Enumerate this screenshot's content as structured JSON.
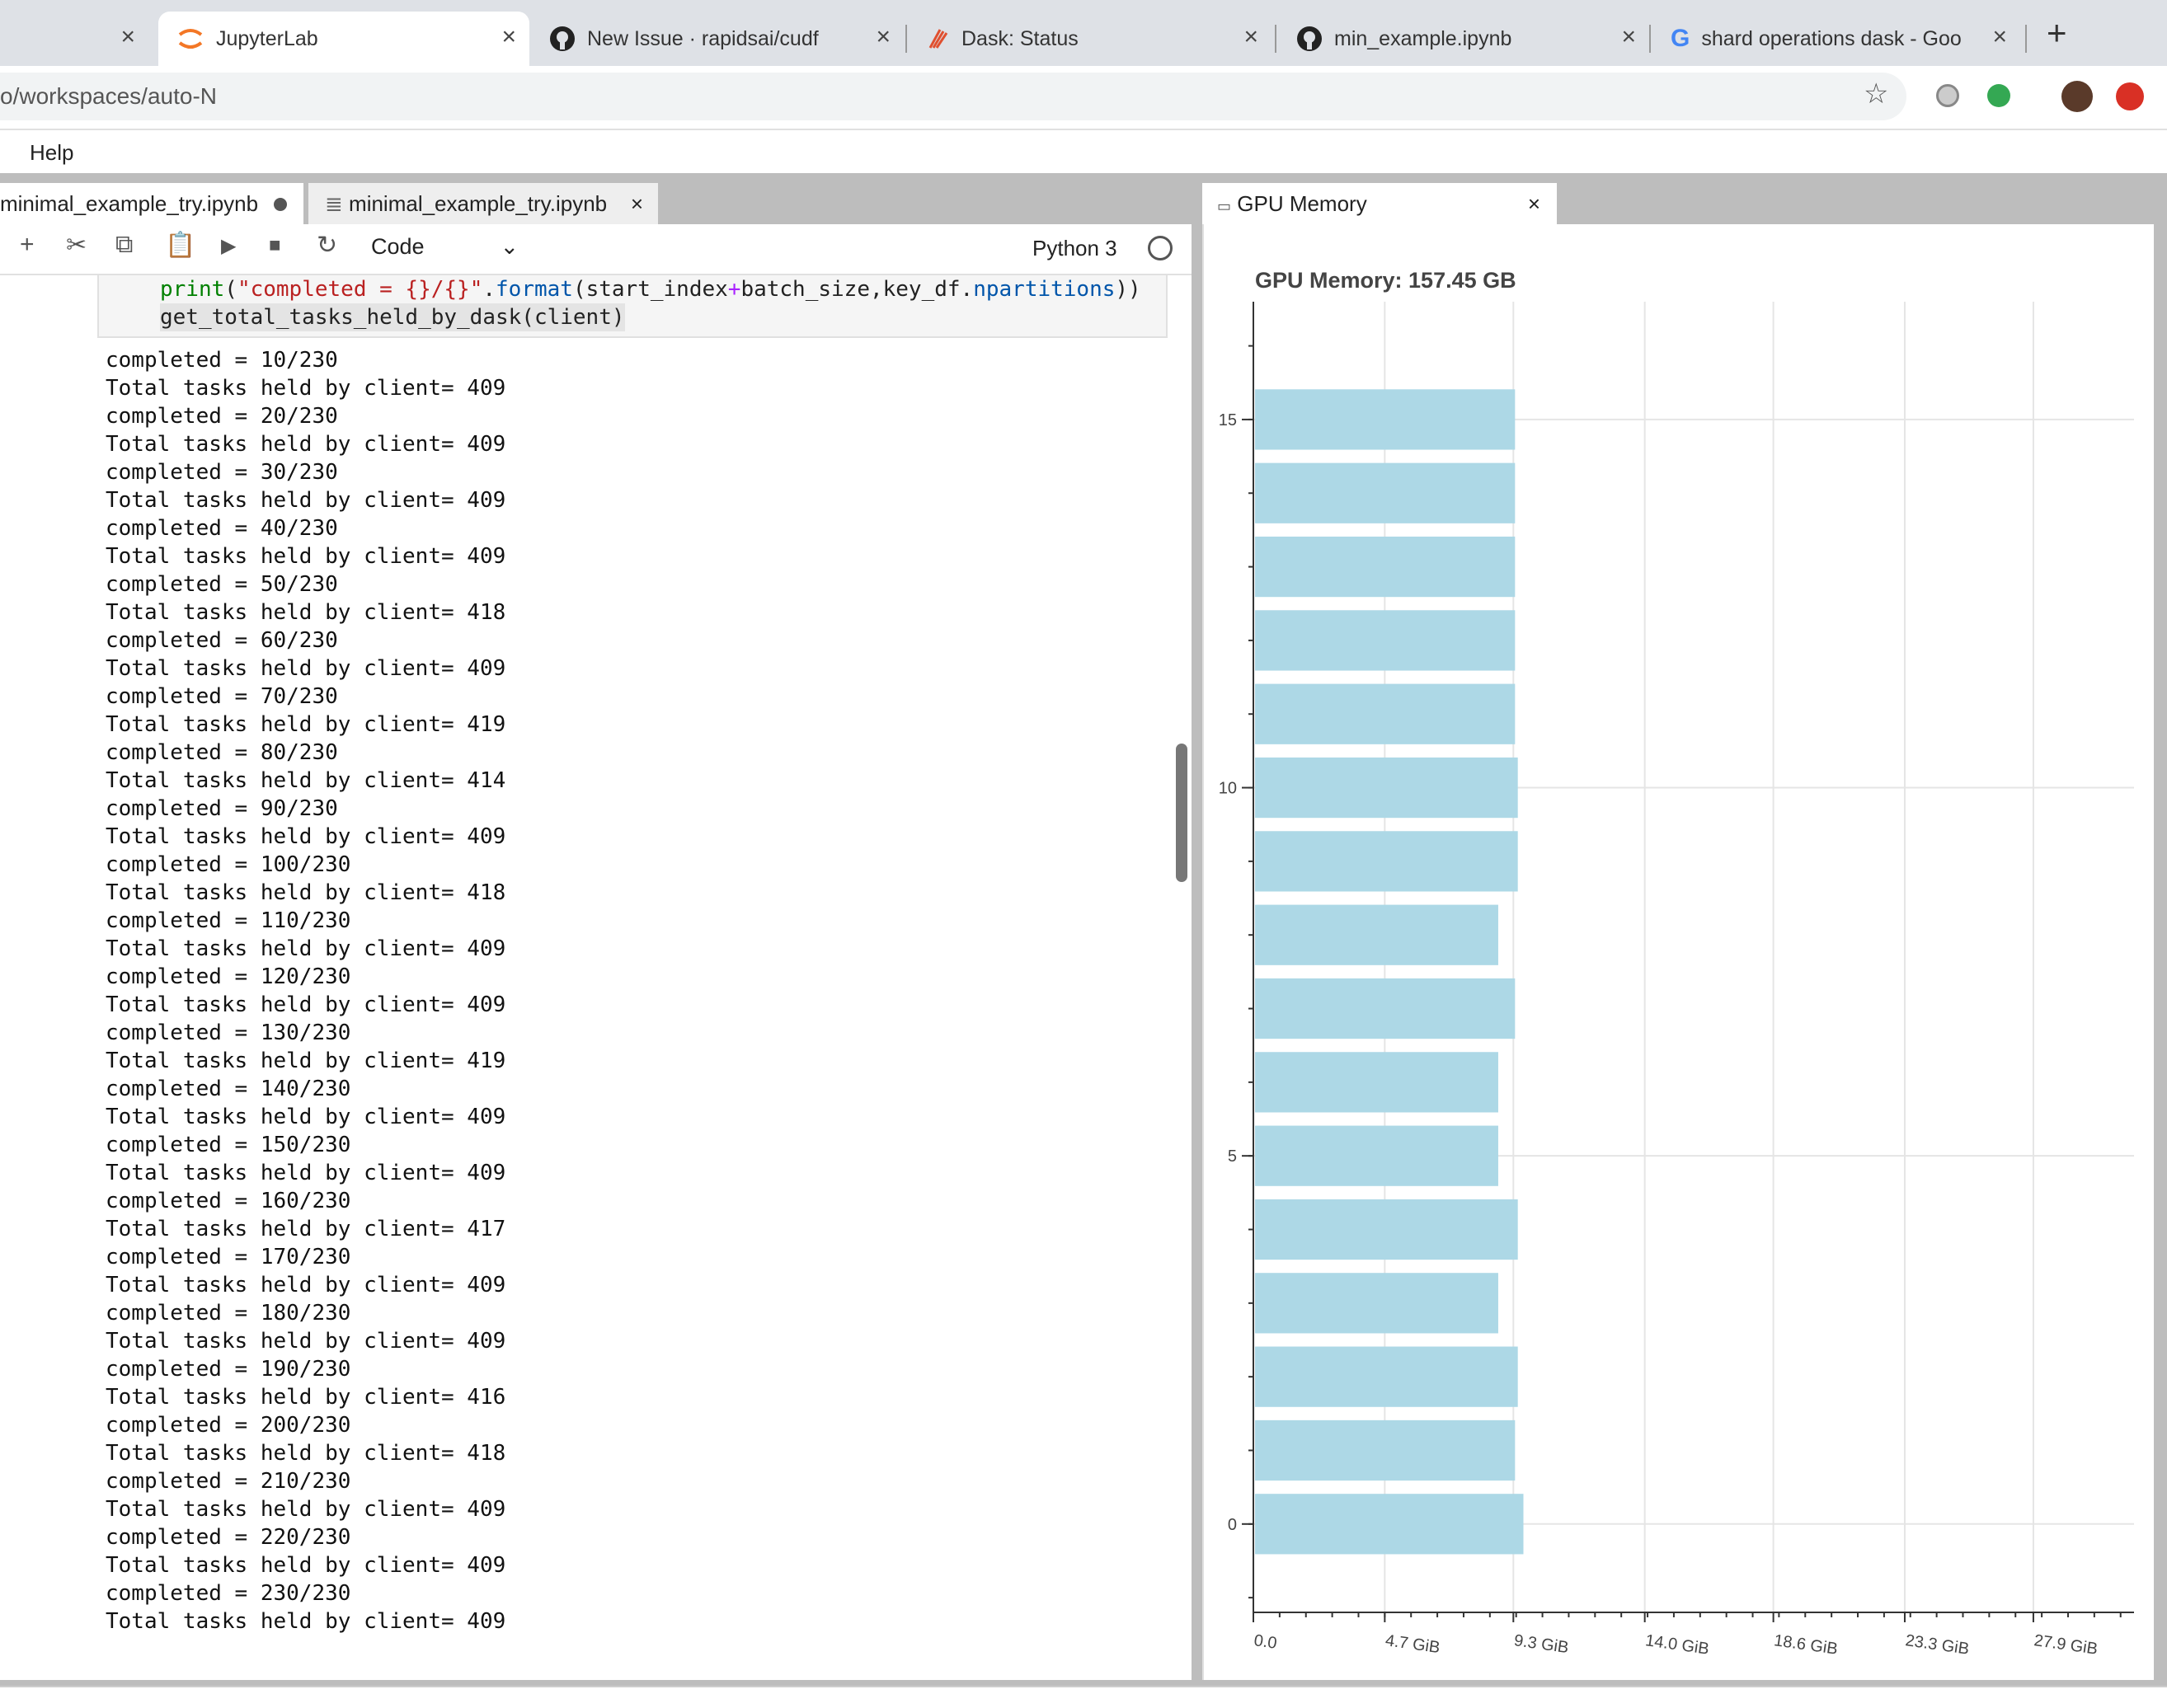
{
  "browser": {
    "tabs": [
      {
        "title": "JupyterLab",
        "active": true,
        "icon": "jupyter-icon"
      },
      {
        "title": "New Issue · rapidsai/cudf",
        "icon": "github-icon"
      },
      {
        "title": "Dask: Status",
        "icon": "dask-icon"
      },
      {
        "title": "min_example.ipynb",
        "icon": "github-icon"
      },
      {
        "title": "shard operations dask - Goo",
        "icon": "google-icon"
      }
    ],
    "url": "o/workspaces/auto-N"
  },
  "jupyter": {
    "menu": {
      "help": "Help"
    },
    "notebook_tabs": [
      {
        "title": "minimal_example_try.ipynb",
        "modified": true
      },
      {
        "title": "minimal_example_try.ipynb"
      }
    ],
    "cell_type": "Code",
    "kernel": "Python 3",
    "code": {
      "line1": {
        "func": "print",
        "open": "(",
        "str": "\"completed = {}/{}\"",
        "dot": ".",
        "method": "format",
        "args_a": "(start_index",
        "plus": "+",
        "args_b": "batch_size,key_df.",
        "attr": "npartitions",
        "close": "))"
      },
      "line2": "get_total_tasks_held_by_dask(client)"
    },
    "output_lines": [
      "completed = 10/230",
      "Total tasks held by client= 409",
      "completed = 20/230",
      "Total tasks held by client= 409",
      "completed = 30/230",
      "Total tasks held by client= 409",
      "completed = 40/230",
      "Total tasks held by client= 409",
      "completed = 50/230",
      "Total tasks held by client= 418",
      "completed = 60/230",
      "Total tasks held by client= 409",
      "completed = 70/230",
      "Total tasks held by client= 419",
      "completed = 80/230",
      "Total tasks held by client= 414",
      "completed = 90/230",
      "Total tasks held by client= 409",
      "completed = 100/230",
      "Total tasks held by client= 418",
      "completed = 110/230",
      "Total tasks held by client= 409",
      "completed = 120/230",
      "Total tasks held by client= 409",
      "completed = 130/230",
      "Total tasks held by client= 419",
      "completed = 140/230",
      "Total tasks held by client= 409",
      "completed = 150/230",
      "Total tasks held by client= 409",
      "completed = 160/230",
      "Total tasks held by client= 417",
      "completed = 170/230",
      "Total tasks held by client= 409",
      "completed = 180/230",
      "Total tasks held by client= 409",
      "completed = 190/230",
      "Total tasks held by client= 416",
      "completed = 200/230",
      "Total tasks held by client= 418",
      "completed = 210/230",
      "Total tasks held by client= 409",
      "completed = 220/230",
      "Total tasks held by client= 409",
      "completed = 230/230",
      "Total tasks held by client= 409"
    ],
    "gpu_panel": {
      "tab_title": "GPU Memory"
    }
  },
  "colors": {
    "bar": "#add8e6",
    "grid": "#e5e5e5",
    "axis": "#333333",
    "tabstrip": "#dee1e6"
  },
  "chart_data": {
    "type": "bar",
    "orientation": "horizontal",
    "title": "GPU Memory: 157.45 GB",
    "y": [
      0,
      1,
      2,
      3,
      4,
      5,
      6,
      7,
      8,
      9,
      10,
      11,
      12,
      13,
      14,
      15
    ],
    "values": [
      9.6,
      9.3,
      9.4,
      8.7,
      9.4,
      8.7,
      8.7,
      9.3,
      8.7,
      9.4,
      9.4,
      9.3,
      9.3,
      9.3,
      9.3,
      9.3
    ],
    "xlim": [
      0,
      31.5
    ],
    "ylim": [
      -1.2,
      16.6
    ],
    "xticks": [
      0,
      4.7,
      9.3,
      14.0,
      18.6,
      23.3,
      27.9
    ],
    "xtick_labels": [
      "0.0",
      "4.7 GiB",
      "9.3 GiB",
      "14.0 GiB",
      "18.6 GiB",
      "23.3 GiB",
      "27.9 GiB"
    ],
    "yticks": [
      0,
      5,
      10,
      15
    ],
    "ytick_labels": [
      "0",
      "5",
      "10",
      "15"
    ],
    "grid": true,
    "legend": "none"
  }
}
